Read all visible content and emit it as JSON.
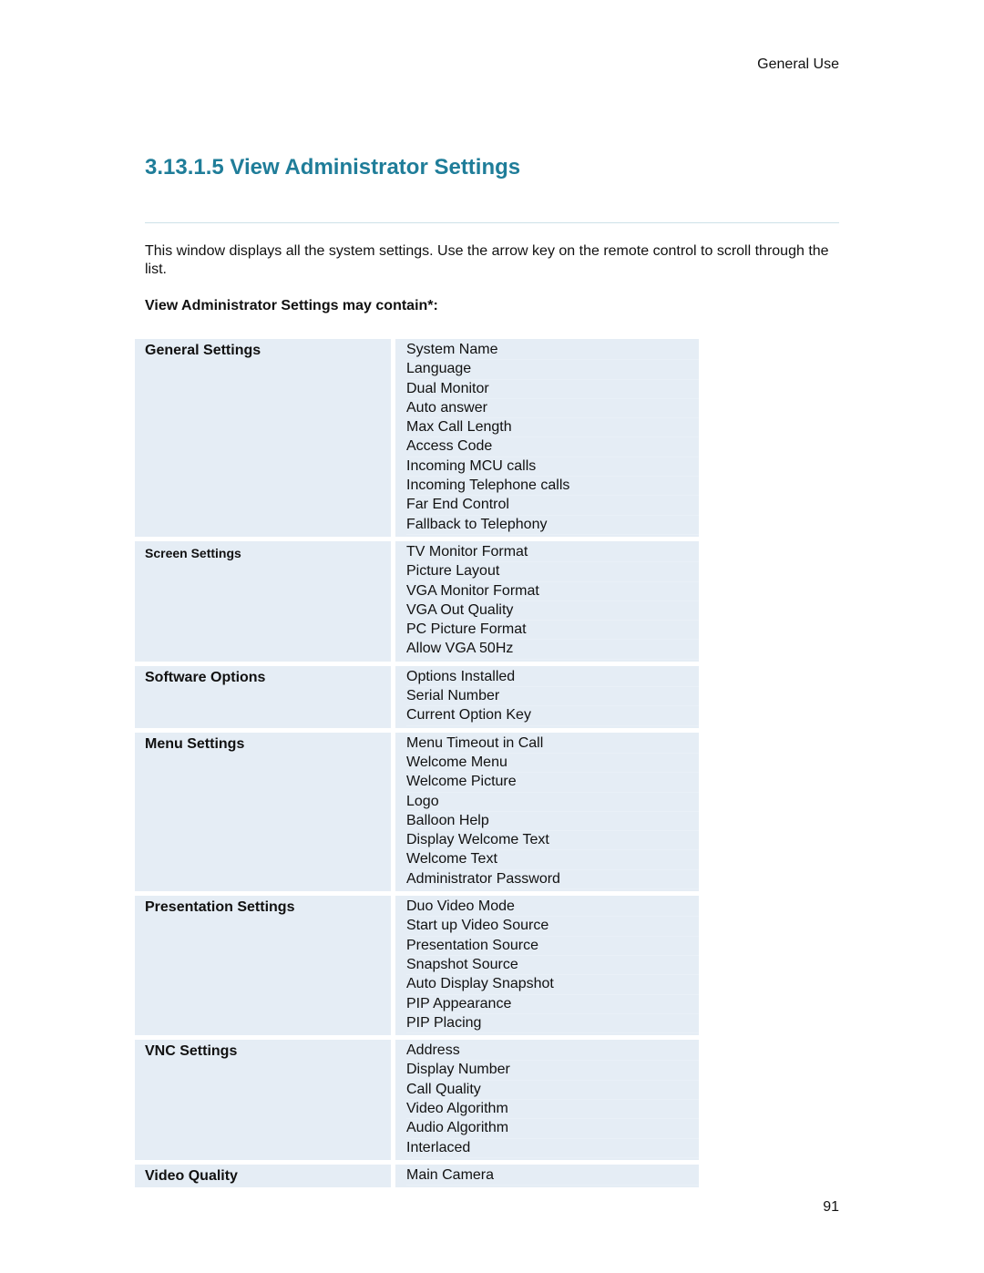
{
  "running_header": "General Use",
  "heading": "3.13.1.5 View Administrator Settings",
  "intro": "This window displays all the system settings. Use the arrow key on the remote control to scroll through the list.",
  "subheading": "View Administrator Settings may contain*:",
  "colors": {
    "heading": "#1f7d99",
    "cell_background": "#e5edf5",
    "rule": "#cde2e8"
  },
  "settings": [
    {
      "category": "General Settings",
      "items": [
        "System Name",
        "Language",
        "Dual Monitor",
        "Auto answer",
        "Max Call Length",
        "Access Code",
        "Incoming MCU calls",
        "Incoming Telephone calls",
        "Far End Control",
        "Fallback to Telephony"
      ]
    },
    {
      "category": "Screen Settings",
      "items": [
        "TV Monitor Format",
        "Picture Layout",
        "VGA Monitor Format",
        "VGA Out Quality",
        "PC Picture Format",
        "Allow VGA 50Hz"
      ]
    },
    {
      "category": "Software Options",
      "items": [
        "Options Installed",
        "Serial Number",
        "Current Option Key"
      ]
    },
    {
      "category": "Menu Settings",
      "items": [
        "Menu Timeout in Call",
        "Welcome Menu",
        "Welcome Picture",
        "Logo",
        "Balloon Help",
        "Display Welcome Text",
        "Welcome Text",
        "Administrator Password"
      ]
    },
    {
      "category": "Presentation Settings",
      "items": [
        "Duo Video Mode",
        "Start up Video Source",
        "Presentation Source",
        "Snapshot Source",
        "Auto Display Snapshot",
        "PIP Appearance",
        "PIP Placing"
      ]
    },
    {
      "category": "VNC Settings",
      "items": [
        "Address",
        "Display Number",
        "Call Quality",
        "Video Algorithm",
        "Audio Algorithm",
        "Interlaced"
      ]
    },
    {
      "category": "Video Quality",
      "items": [
        "Main Camera"
      ]
    }
  ],
  "page_number": "91"
}
